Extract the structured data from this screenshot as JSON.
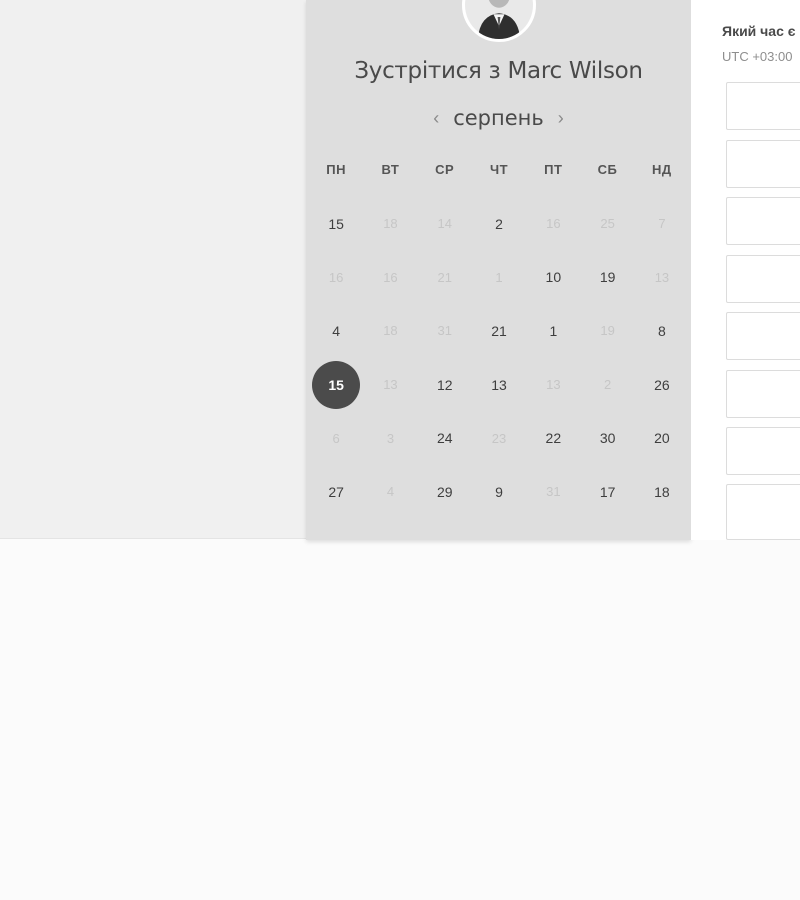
{
  "host": {
    "title": "Зустрітися з Marc Wilson",
    "avatar_icon": "person-photo"
  },
  "calendar": {
    "month": "серпень",
    "prev_icon": "chevron-left-icon",
    "next_icon": "chevron-right-icon",
    "weekdays": [
      "ПН",
      "ВТ",
      "СР",
      "ЧТ",
      "ПТ",
      "СБ",
      "НД"
    ],
    "selected": "15",
    "days": [
      {
        "label": "15",
        "available": true
      },
      {
        "label": "18",
        "available": false
      },
      {
        "label": "14",
        "available": false
      },
      {
        "label": "2",
        "available": true
      },
      {
        "label": "16",
        "available": false
      },
      {
        "label": "25",
        "available": false
      },
      {
        "label": "7",
        "available": false
      },
      {
        "label": "16",
        "available": false
      },
      {
        "label": "16",
        "available": false
      },
      {
        "label": "21",
        "available": false
      },
      {
        "label": "1",
        "available": false
      },
      {
        "label": "10",
        "available": true
      },
      {
        "label": "19",
        "available": true
      },
      {
        "label": "13",
        "available": false
      },
      {
        "label": "4",
        "available": true
      },
      {
        "label": "18",
        "available": false
      },
      {
        "label": "31",
        "available": false
      },
      {
        "label": "21",
        "available": true
      },
      {
        "label": "1",
        "available": true
      },
      {
        "label": "19",
        "available": false
      },
      {
        "label": "8",
        "available": true
      },
      {
        "label": "15",
        "available": true,
        "selected": true
      },
      {
        "label": "13",
        "available": false
      },
      {
        "label": "12",
        "available": true
      },
      {
        "label": "13",
        "available": true
      },
      {
        "label": "13",
        "available": false
      },
      {
        "label": "2",
        "available": false
      },
      {
        "label": "26",
        "available": true
      },
      {
        "label": "6",
        "available": false
      },
      {
        "label": "3",
        "available": false
      },
      {
        "label": "24",
        "available": true
      },
      {
        "label": "23",
        "available": false
      },
      {
        "label": "22",
        "available": true
      },
      {
        "label": "30",
        "available": true
      },
      {
        "label": "20",
        "available": true
      },
      {
        "label": "27",
        "available": true
      },
      {
        "label": "4",
        "available": false
      },
      {
        "label": "29",
        "available": true
      },
      {
        "label": "9",
        "available": true
      },
      {
        "label": "31",
        "available": false
      },
      {
        "label": "17",
        "available": true
      },
      {
        "label": "18",
        "available": true
      }
    ]
  },
  "times": {
    "question": "Який час є",
    "timezone": "UTC +03:00",
    "slot_count": 8
  },
  "colors": {
    "selected_day": "#4b4b4b",
    "panel_bg": "#dedede",
    "page_bg": "#f0f0f0"
  }
}
